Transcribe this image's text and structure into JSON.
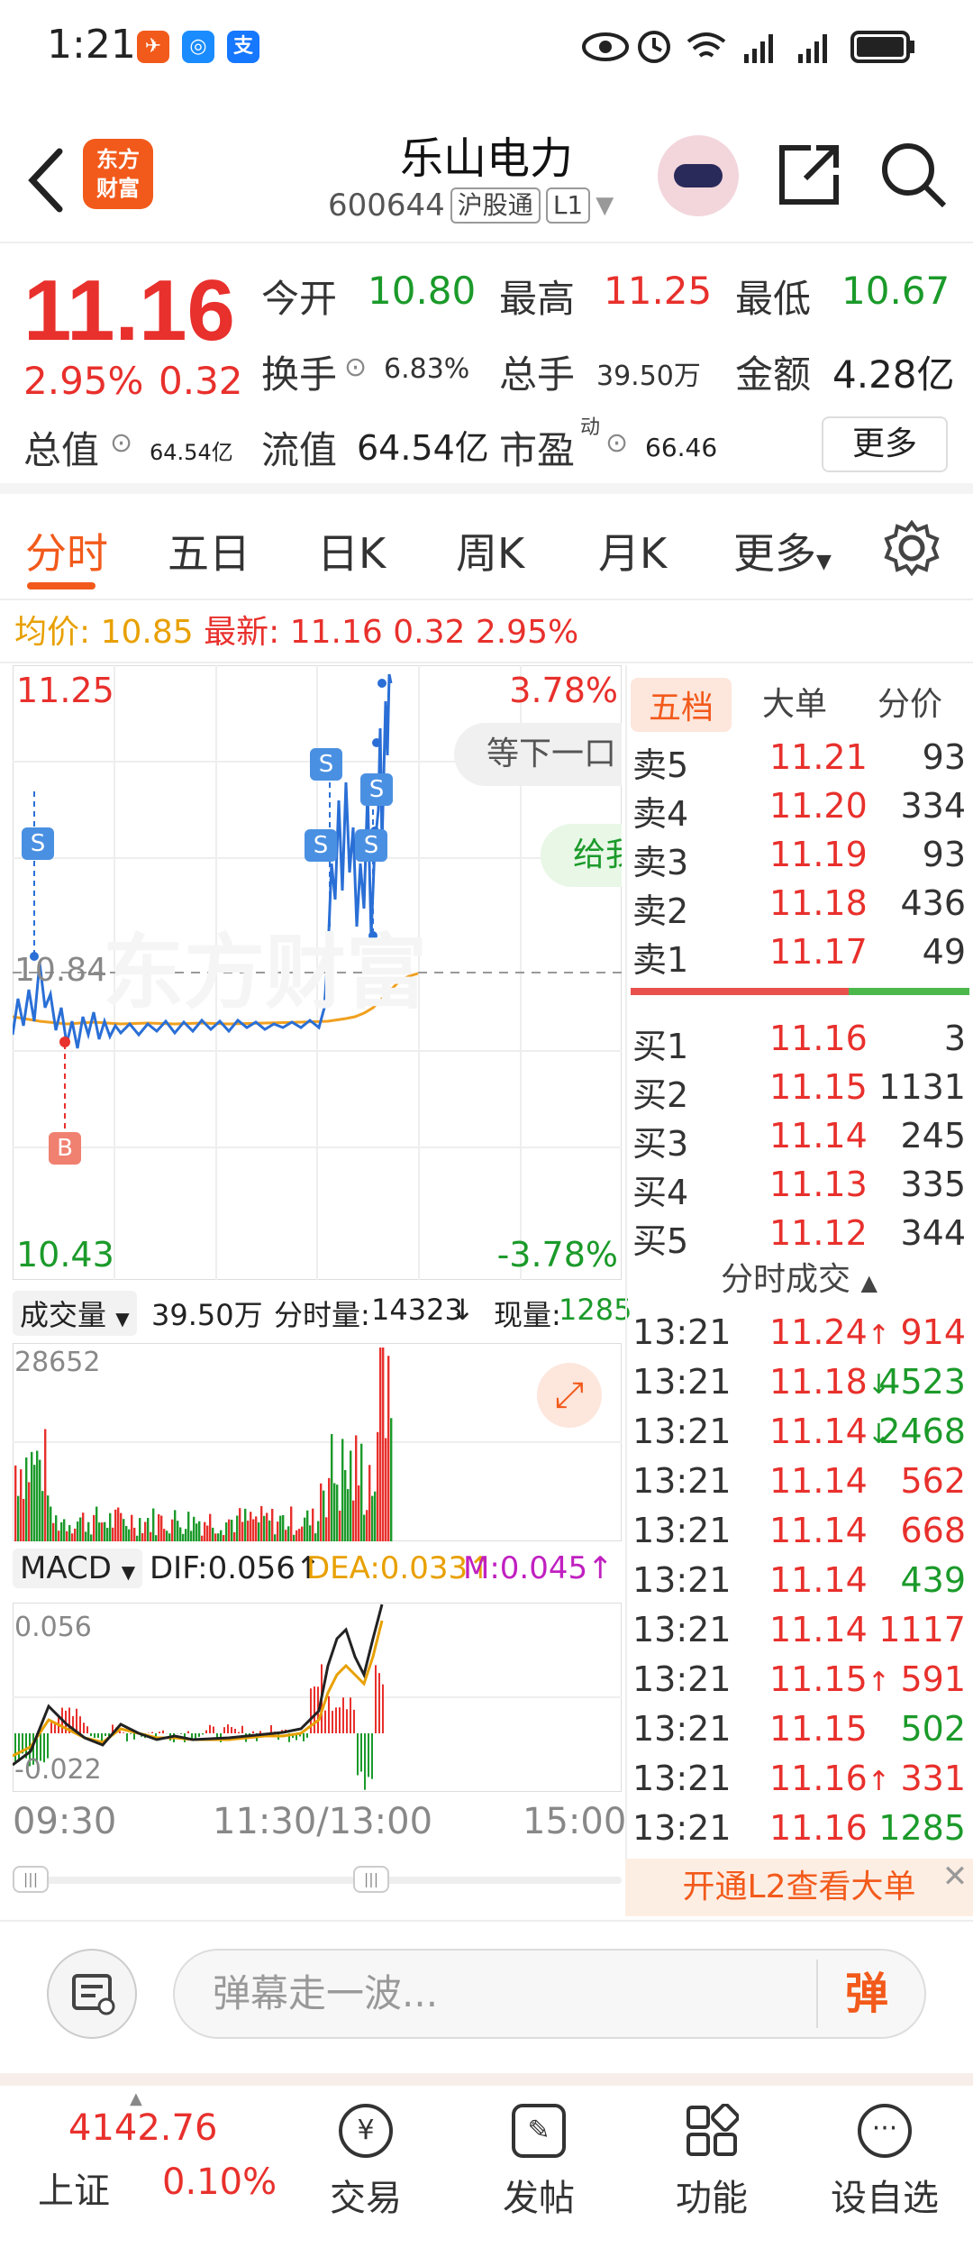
{
  "status_bar": {
    "time": "1:21"
  },
  "header": {
    "title": "乐山电力",
    "code": "600644",
    "market_tag": "沪股通",
    "level_tag": "L1",
    "logo_text": "东方财富"
  },
  "quote": {
    "price": "11.16",
    "change_pct": "2.95%",
    "change": "0.32",
    "open_label": "今开",
    "open": "10.80",
    "high_label": "最高",
    "high": "11.25",
    "low_label": "最低",
    "low": "10.67",
    "turnover_label": "换手",
    "turnover": "6.83%",
    "volume_label": "总手",
    "volume": "39.50万",
    "amount_label": "金额",
    "amount": "4.28亿",
    "mktcap_label": "总值",
    "mktcap": "64.54亿",
    "float_label": "流值",
    "float": "64.54亿",
    "pe_label": "市盈",
    "pe_sup": "动",
    "pe": "66.46",
    "more_label": "更多"
  },
  "tabs": [
    "分时",
    "五日",
    "日K",
    "周K",
    "月K",
    "更多"
  ],
  "avg_line": {
    "avg_label": "均价:",
    "avg": "10.85",
    "last_label": "最新:",
    "last": "11.16",
    "chg": "0.32",
    "pct": "2.95%"
  },
  "chart": {
    "ymax": "11.25",
    "ymax_pct": "3.78%",
    "ymin": "10.43",
    "ymin_pct": "-3.78%",
    "mid": "10.84",
    "wait_text": "等下一口",
    "give_text": "给我",
    "watermark": "东方财富",
    "signal_s": "S",
    "signal_b": "B"
  },
  "volume_bar": {
    "label": "成交量",
    "total": "39.50万",
    "min_label": "分时量:",
    "min_value": "14323",
    "now_label": "现量:",
    "now_value": "1285",
    "max": "28652"
  },
  "macd_bar": {
    "label": "MACD",
    "dif": "DIF:0.056",
    "dea": "DEA:0.033",
    "m": "M:0.045",
    "top": "0.056",
    "bottom": "-0.022"
  },
  "time_axis": {
    "t1": "09:30",
    "t2": "11:30/13:00",
    "t3": "15:00"
  },
  "book": {
    "tabs": [
      "五档",
      "大单",
      "分价"
    ],
    "sells": [
      {
        "label": "卖5",
        "price": "11.21",
        "vol": "93"
      },
      {
        "label": "卖4",
        "price": "11.20",
        "vol": "334"
      },
      {
        "label": "卖3",
        "price": "11.19",
        "vol": "93"
      },
      {
        "label": "卖2",
        "price": "11.18",
        "vol": "436"
      },
      {
        "label": "卖1",
        "price": "11.17",
        "vol": "49"
      }
    ],
    "buys": [
      {
        "label": "买1",
        "price": "11.16",
        "vol": "3"
      },
      {
        "label": "买2",
        "price": "11.15",
        "vol": "1131"
      },
      {
        "label": "买3",
        "price": "11.14",
        "vol": "245"
      },
      {
        "label": "买4",
        "price": "11.13",
        "vol": "335"
      },
      {
        "label": "买5",
        "price": "11.12",
        "vol": "344"
      }
    ],
    "trades_title": "分时成交",
    "trades": [
      {
        "time": "13:21",
        "price": "11.24",
        "arrow": "↑",
        "vol": "914",
        "color": "red"
      },
      {
        "time": "13:21",
        "price": "11.18",
        "arrow": "↓",
        "vol": "4523",
        "color": "green"
      },
      {
        "time": "13:21",
        "price": "11.14",
        "arrow": "↓",
        "vol": "2468",
        "color": "green"
      },
      {
        "time": "13:21",
        "price": "11.14",
        "arrow": "",
        "vol": "562",
        "color": "red"
      },
      {
        "time": "13:21",
        "price": "11.14",
        "arrow": "",
        "vol": "668",
        "color": "red"
      },
      {
        "time": "13:21",
        "price": "11.14",
        "arrow": "",
        "vol": "439",
        "color": "green"
      },
      {
        "time": "13:21",
        "price": "11.14",
        "arrow": "",
        "vol": "1117",
        "color": "red"
      },
      {
        "time": "13:21",
        "price": "11.15",
        "arrow": "↑",
        "vol": "591",
        "color": "red"
      },
      {
        "time": "13:21",
        "price": "11.15",
        "arrow": "",
        "vol": "502",
        "color": "green"
      },
      {
        "time": "13:21",
        "price": "11.16",
        "arrow": "↑",
        "vol": "331",
        "color": "red"
      },
      {
        "time": "13:21",
        "price": "11.16",
        "arrow": "",
        "vol": "1285",
        "color": "green"
      }
    ],
    "l2_text": "开通L2查看大单"
  },
  "comment": {
    "placeholder": "弹幕走一波...",
    "dan": "弹"
  },
  "bottom_nav": {
    "index_value": "4142.76",
    "index_name": "上证",
    "index_pct": "0.10%",
    "items": [
      "交易",
      "发帖",
      "功能",
      "设自选"
    ]
  },
  "colors": {
    "up": "#e8302c",
    "down": "#1b9a2a",
    "brand": "#f25a1b",
    "avg": "#f0a020",
    "price_line": "#2a6fd6"
  }
}
